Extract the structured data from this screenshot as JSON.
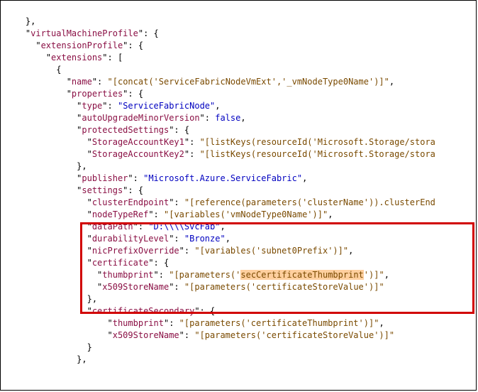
{
  "top": {
    "closebrace": "},",
    "virtualMachineProfile": "virtualMachineProfile",
    "extensionProfile": "extensionProfile",
    "extensions": "extensions"
  },
  "name": {
    "key": "name",
    "value": "[concat('ServiceFabricNodeVmExt','_vmNodeType0Name')]"
  },
  "props": {
    "key": "properties",
    "type": {
      "key": "type",
      "value": "ServiceFabricNode"
    },
    "autoUpgrade": {
      "key": "autoUpgradeMinorVersion",
      "value": "false"
    },
    "protected": {
      "key": "protectedSettings",
      "sak1": {
        "key": "StorageAccountKey1",
        "value": "[listKeys(resourceId('Microsoft.Storage/stora"
      },
      "sak2": {
        "key": "StorageAccountKey2",
        "value": "[listKeys(resourceId('Microsoft.Storage/stora"
      }
    },
    "publisher": {
      "key": "publisher",
      "value": "Microsoft.Azure.ServiceFabric"
    },
    "settings": {
      "key": "settings",
      "clusterEndpoint": {
        "key": "clusterEndpoint",
        "value": "[reference(parameters('clusterName')).clusterEnd"
      },
      "nodeTypeRef": {
        "key": "nodeTypeRef",
        "value": "[variables('vmNodeType0Name')]"
      },
      "dataPath": {
        "key": "dataPath",
        "value": "D:\\\\\\\\SvcFab"
      },
      "durabilityLevel": {
        "key": "durabilityLevel",
        "value": "Bronze"
      },
      "nicPrefixOverride": {
        "key": "nicPrefixOverride",
        "value": "[variables('subnet0Prefix')]"
      },
      "certificate": {
        "key": "certificate",
        "thumbprint": {
          "key": "thumbprint",
          "prefix": "[parameters('",
          "hl": "secC",
          "mid": "ertificateThumbprint",
          "suffix": "')]"
        },
        "store": {
          "key": "x509StoreName",
          "value": "[parameters('certificateStoreValue')]"
        }
      },
      "certificateSecondary": {
        "key": "certificateSecondary",
        "thumbprint": {
          "key": "thumbprint",
          "value": "[parameters('certificateThumbprint')]"
        },
        "store": {
          "key": "x509StoreName",
          "value": "[parameters('certificateStoreValue')]"
        }
      }
    }
  },
  "chart_data": {
    "type": "table",
    "description": "Azure ARM template JSON fragment showing virtualMachineProfile.extensionProfile.extensions[0] with certificate settings highlighted",
    "highlighted_block": "certificate & certificateSecondary",
    "selected_text": "secCertificateThumbprint",
    "certificate": {
      "thumbprint": "[parameters('secCertificateThumbprint')]",
      "x509StoreName": "[parameters('certificateStoreValue')]"
    },
    "certificateSecondary": {
      "thumbprint": "[parameters('certificateThumbprint')]",
      "x509StoreName": "[parameters('certificateStoreValue')]"
    }
  }
}
